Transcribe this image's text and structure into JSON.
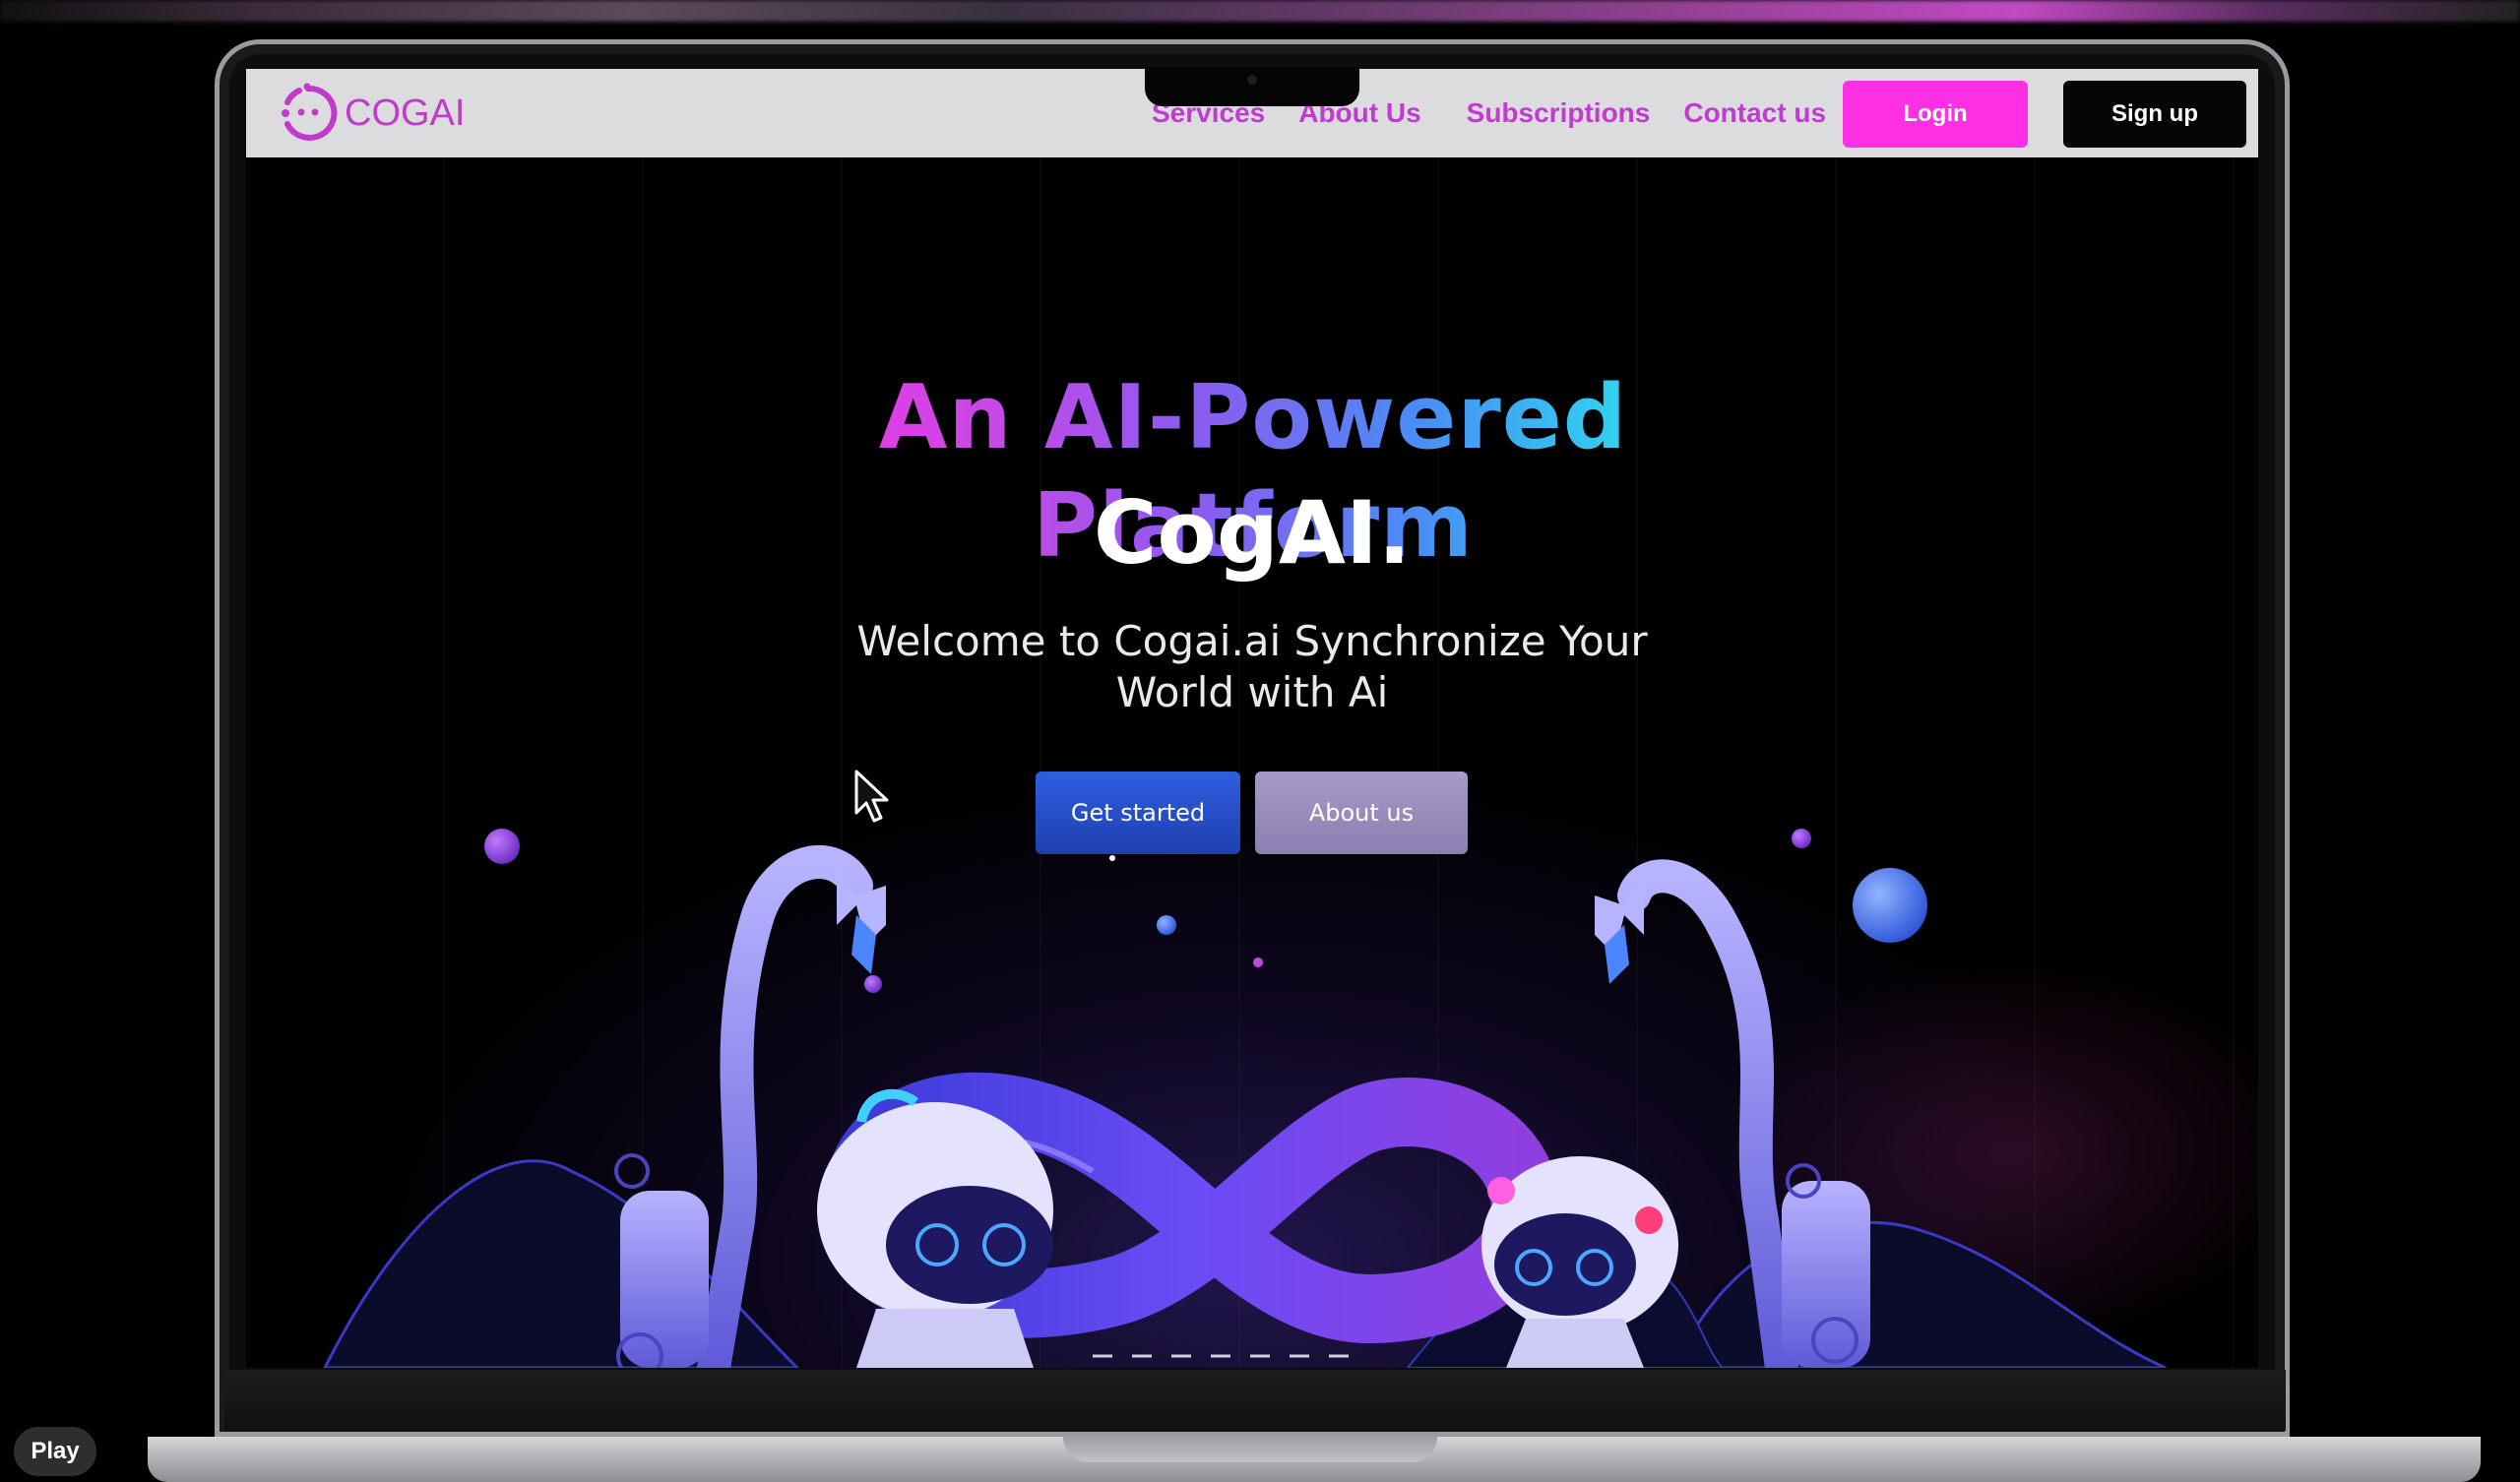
{
  "brand": {
    "name": "COGAI",
    "primary_color": "#c03acb",
    "login_color": "#ff2fe6"
  },
  "nav": {
    "links": [
      "Services",
      "About Us",
      "Subscriptions",
      "Contact us"
    ],
    "login_label": "Login",
    "signup_label": "Sign up"
  },
  "hero": {
    "headline": "An AI-Powered Platform",
    "brand_line": "CogAI.",
    "tagline": "Welcome to Cogai.ai Synchronize Your World with Ai",
    "primary_cta": "Get started",
    "secondary_cta": "About us"
  },
  "player": {
    "play_label": "Play"
  },
  "icons": {
    "logo": "cogai-logo-icon",
    "cursor": "mouse-pointer-icon"
  }
}
